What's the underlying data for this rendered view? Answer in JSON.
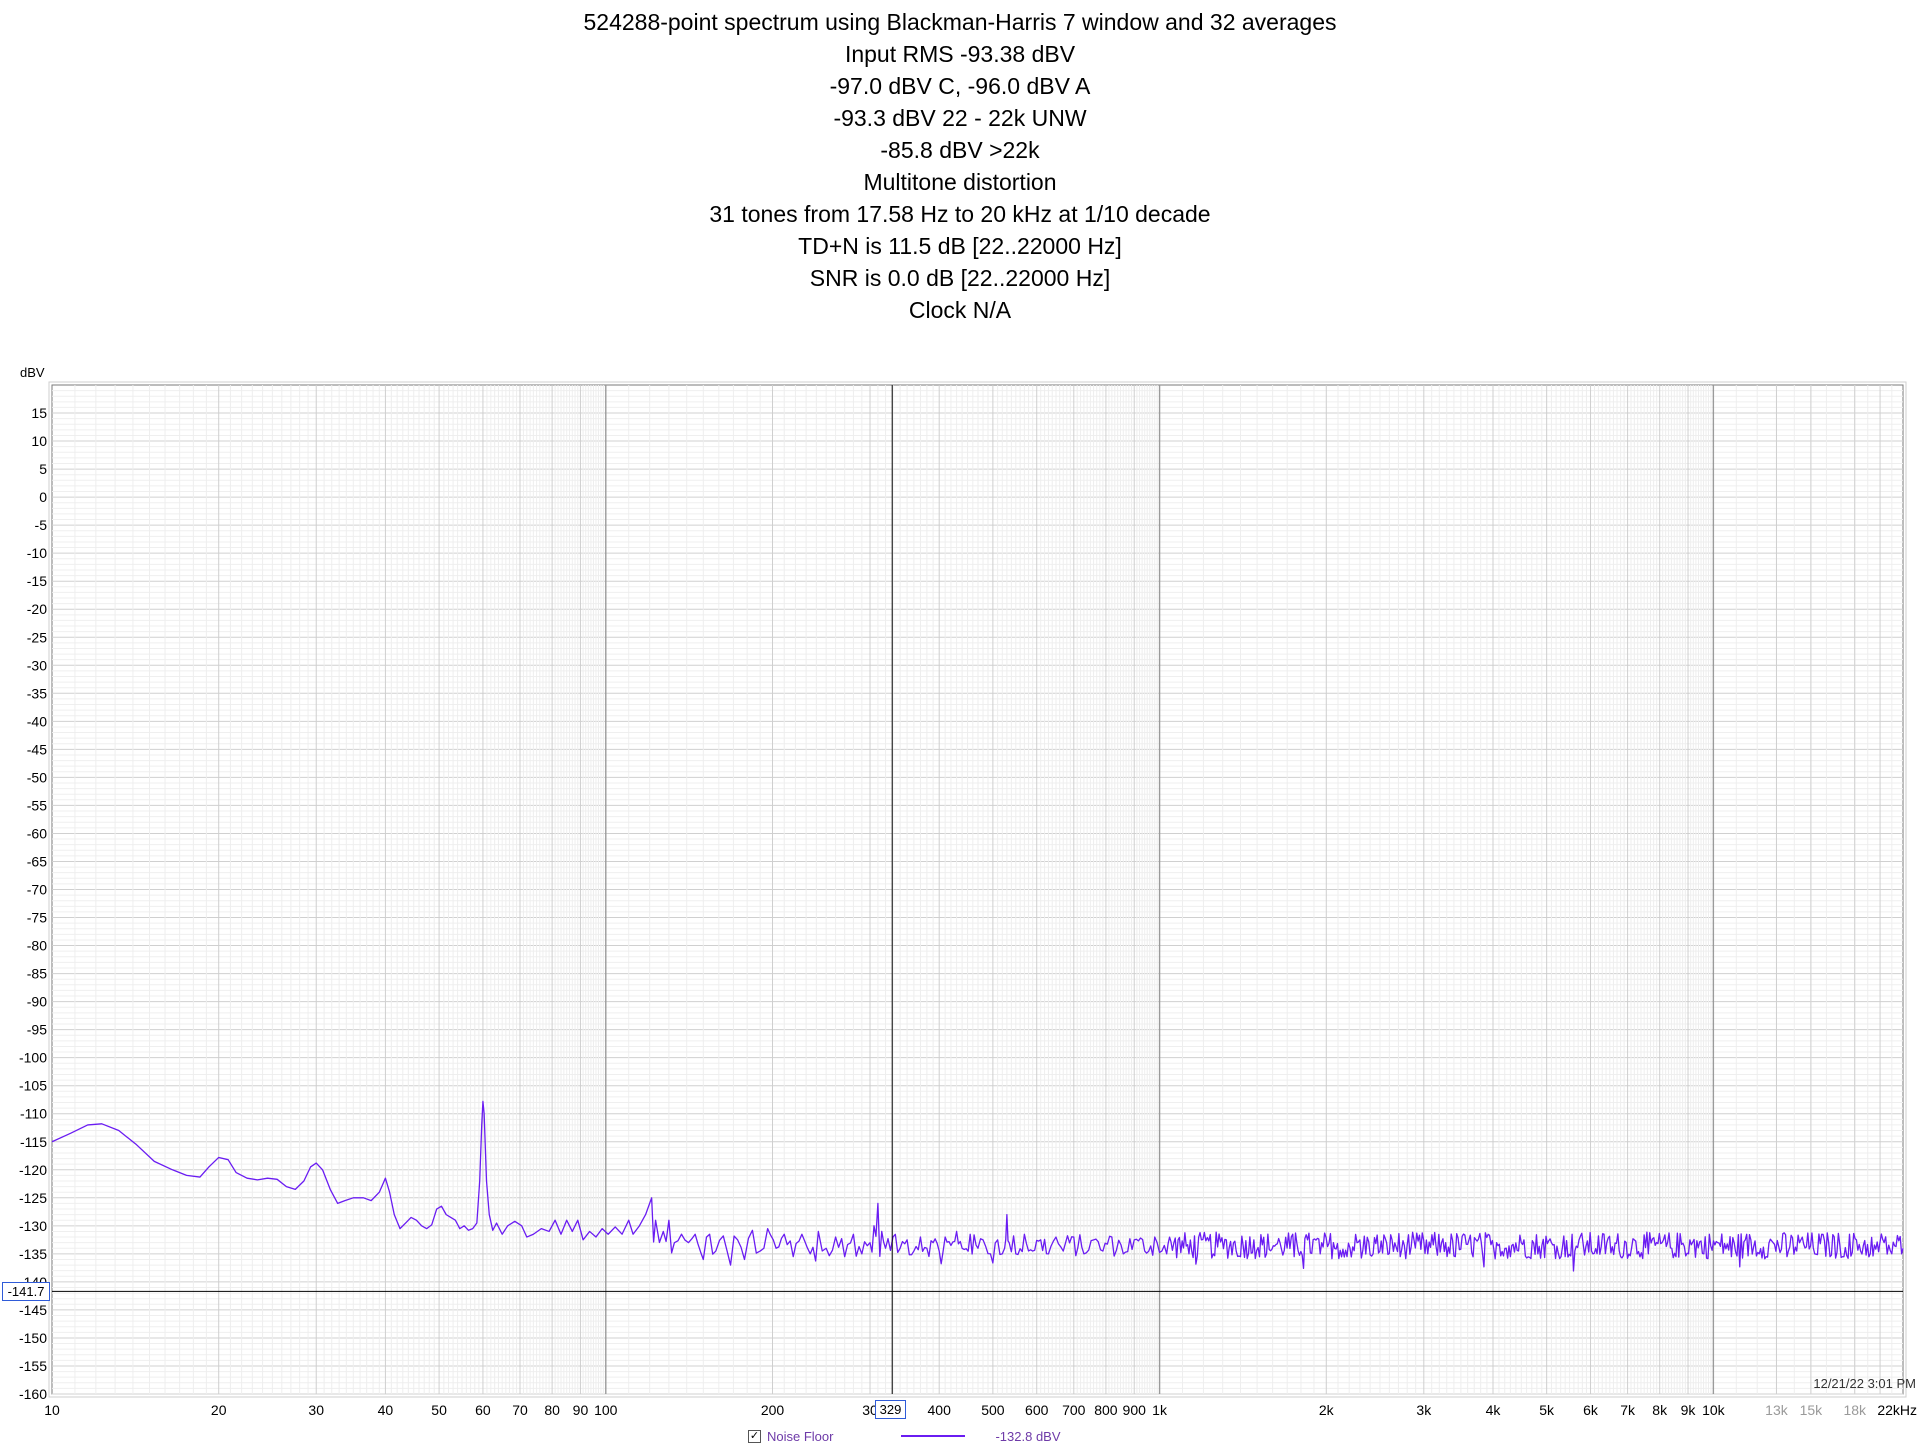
{
  "chart_data": {
    "type": "line",
    "title_lines": [
      "524288-point spectrum using Blackman-Harris 7 window and 32 averages",
      "Input RMS -93.38 dBV",
      "-97.0 dBV C, -96.0 dBV A",
      "-93.3 dBV 22 - 22k UNW",
      "-85.8 dBV >22k",
      "Multitone distortion",
      "31 tones from 17.58 Hz to 20 kHz at 1/10 decade",
      "TD+N is 11.5 dB [22..22000 Hz]",
      "SNR is 0.0 dB [22..22000 Hz]",
      "Clock N/A"
    ],
    "ylabel": "dBV",
    "xlabel": "Hz",
    "x_scale": "log",
    "xlim": [
      10,
      22000
    ],
    "ylim": [
      -160,
      20
    ],
    "y_ticks": [
      15,
      10,
      5,
      0,
      -5,
      -10,
      -15,
      -20,
      -25,
      -30,
      -35,
      -40,
      -45,
      -50,
      -55,
      -60,
      -65,
      -70,
      -75,
      -80,
      -85,
      -90,
      -95,
      -100,
      -105,
      -110,
      -115,
      -120,
      -125,
      -130,
      -135,
      -140,
      -145,
      -150,
      -155,
      -160
    ],
    "x_ticks": [
      {
        "value": 10,
        "label": "10"
      },
      {
        "value": 20,
        "label": "20"
      },
      {
        "value": 30,
        "label": "30"
      },
      {
        "value": 40,
        "label": "40"
      },
      {
        "value": 50,
        "label": "50"
      },
      {
        "value": 60,
        "label": "60"
      },
      {
        "value": 70,
        "label": "70"
      },
      {
        "value": 80,
        "label": "80"
      },
      {
        "value": 90,
        "label": "90"
      },
      {
        "value": 100,
        "label": "100"
      },
      {
        "value": 200,
        "label": "200"
      },
      {
        "value": 300,
        "label": "30"
      },
      {
        "value": 400,
        "label": "400"
      },
      {
        "value": 500,
        "label": "500"
      },
      {
        "value": 600,
        "label": "600"
      },
      {
        "value": 700,
        "label": "700"
      },
      {
        "value": 800,
        "label": "800"
      },
      {
        "value": 900,
        "label": "900"
      },
      {
        "value": 1000,
        "label": "1k"
      },
      {
        "value": 2000,
        "label": "2k"
      },
      {
        "value": 3000,
        "label": "3k"
      },
      {
        "value": 4000,
        "label": "4k"
      },
      {
        "value": 5000,
        "label": "5k"
      },
      {
        "value": 6000,
        "label": "6k"
      },
      {
        "value": 7000,
        "label": "7k"
      },
      {
        "value": 8000,
        "label": "8k"
      },
      {
        "value": 9000,
        "label": "9k"
      },
      {
        "value": 10000,
        "label": "10k"
      },
      {
        "value": 13000,
        "label": "13k",
        "dim": true
      },
      {
        "value": 15000,
        "label": "15k",
        "dim": true
      },
      {
        "value": 18000,
        "label": "18k",
        "dim": true
      },
      {
        "value": 22000,
        "label": "22kHz"
      }
    ],
    "grid": true,
    "series": [
      {
        "name": "Noise Floor",
        "color": "#6a1cf2",
        "points": [
          [
            10,
            -115
          ],
          [
            10.8,
            -113.5
          ],
          [
            11.6,
            -112
          ],
          [
            12.3,
            -111.8
          ],
          [
            13.2,
            -113
          ],
          [
            14.2,
            -115.5
          ],
          [
            15.3,
            -118.5
          ],
          [
            16.5,
            -120
          ],
          [
            17.5,
            -121
          ],
          [
            18.5,
            -121.3
          ],
          [
            19.2,
            -119.5
          ],
          [
            20,
            -117.8
          ],
          [
            20.8,
            -118.2
          ],
          [
            21.5,
            -120.5
          ],
          [
            22.5,
            -121.5
          ],
          [
            23.5,
            -121.8
          ],
          [
            24.5,
            -121.5
          ],
          [
            25.5,
            -121.7
          ],
          [
            26.5,
            -123
          ],
          [
            27.5,
            -123.5
          ],
          [
            28.5,
            -122
          ],
          [
            29.3,
            -119.5
          ],
          [
            30,
            -118.8
          ],
          [
            30.8,
            -120
          ],
          [
            31.8,
            -123.5
          ],
          [
            32.8,
            -126
          ],
          [
            33.8,
            -125.5
          ],
          [
            35,
            -125
          ],
          [
            36.5,
            -125
          ],
          [
            37.7,
            -125.5
          ],
          [
            39,
            -124
          ],
          [
            40,
            -121.5
          ],
          [
            40.7,
            -124
          ],
          [
            41.5,
            -128
          ],
          [
            42.5,
            -130.5
          ],
          [
            43.5,
            -129.5
          ],
          [
            44.5,
            -128.5
          ],
          [
            45.5,
            -129
          ],
          [
            46.5,
            -130
          ],
          [
            47.5,
            -130.5
          ],
          [
            48.5,
            -129.8
          ],
          [
            49.5,
            -127
          ],
          [
            50.5,
            -126.5
          ],
          [
            51.5,
            -128
          ],
          [
            52.5,
            -128.5
          ],
          [
            53.5,
            -129
          ],
          [
            54.5,
            -130.5
          ],
          [
            55.5,
            -130
          ],
          [
            56.5,
            -130.8
          ],
          [
            57.5,
            -130.5
          ],
          [
            58.5,
            -129.5
          ],
          [
            59.2,
            -122
          ],
          [
            59.7,
            -112
          ],
          [
            60,
            -107.8
          ],
          [
            60.3,
            -110
          ],
          [
            60.9,
            -122
          ],
          [
            61.6,
            -128
          ],
          [
            62.5,
            -130.8
          ],
          [
            63.5,
            -129.5
          ],
          [
            65,
            -131.5
          ],
          [
            66.5,
            -130
          ],
          [
            68.5,
            -129.2
          ],
          [
            70.5,
            -130
          ],
          [
            72,
            -132
          ],
          [
            74,
            -131.5
          ],
          [
            76.5,
            -130.5
          ],
          [
            79,
            -131
          ],
          [
            81,
            -129
          ],
          [
            83,
            -131.5
          ],
          [
            85,
            -129
          ],
          [
            87,
            -131
          ],
          [
            89,
            -129
          ],
          [
            91,
            -132.5
          ],
          [
            93.5,
            -131
          ],
          [
            96,
            -132
          ],
          [
            98.5,
            -130.5
          ],
          [
            101,
            -131.5
          ],
          [
            104,
            -130.2
          ],
          [
            107,
            -131.5
          ],
          [
            110,
            -129
          ],
          [
            112,
            -131.5
          ],
          [
            115,
            -130
          ],
          [
            118,
            -128
          ],
          [
            121,
            -125
          ],
          [
            123,
            -129
          ],
          [
            127,
            -131
          ],
          [
            130,
            -129
          ],
          [
            133,
            -133
          ],
          [
            137,
            -131.5
          ],
          [
            141,
            -133
          ],
          [
            145,
            -131.5
          ],
          [
            150,
            -136
          ],
          [
            154,
            -131.5
          ],
          [
            158,
            -134.5
          ],
          [
            163,
            -131.8
          ],
          [
            168,
            -137
          ],
          [
            173,
            -132.5
          ],
          [
            178,
            -136
          ],
          [
            184,
            -130.8
          ],
          [
            190,
            -134.5
          ],
          [
            196,
            -130.5
          ],
          [
            203,
            -134
          ],
          [
            210,
            -131.5
          ],
          [
            218,
            -135.5
          ],
          [
            226,
            -131.5
          ],
          [
            234,
            -135
          ],
          [
            242,
            -131
          ],
          [
            250,
            -134
          ],
          [
            260,
            -132
          ],
          [
            270,
            -135.5
          ],
          [
            280,
            -131.5
          ],
          [
            290,
            -135
          ],
          [
            300,
            -133
          ],
          [
            305,
            -130
          ],
          [
            310,
            -126
          ],
          [
            315,
            -131
          ],
          [
            320,
            -134
          ],
          [
            330,
            -132
          ],
          [
            340,
            -134
          ],
          [
            350,
            -132.5
          ],
          [
            360,
            -134.5
          ],
          [
            370,
            -132
          ],
          [
            380,
            -134
          ],
          [
            390,
            -133
          ],
          [
            400,
            -134.5
          ],
          [
            410,
            -132
          ],
          [
            420,
            -133.5
          ],
          [
            430,
            -131
          ],
          [
            440,
            -134
          ],
          [
            455,
            -131.5
          ],
          [
            470,
            -134
          ],
          [
            480,
            -132.5
          ],
          [
            495,
            -135
          ],
          [
            510,
            -132.5
          ],
          [
            525,
            -134
          ],
          [
            530,
            -128
          ],
          [
            535,
            -133
          ],
          [
            550,
            -135
          ],
          [
            570,
            -131.5
          ],
          [
            590,
            -134.5
          ],
          [
            610,
            -132.5
          ],
          [
            630,
            -135
          ],
          [
            650,
            -132
          ],
          [
            670,
            -134.5
          ],
          [
            700,
            -132
          ],
          [
            730,
            -135
          ],
          [
            760,
            -132.5
          ],
          [
            790,
            -134.5
          ],
          [
            820,
            -132
          ],
          [
            860,
            -135
          ],
          [
            900,
            -132.5
          ],
          [
            940,
            -134.5
          ],
          [
            980,
            -132
          ],
          [
            1030,
            -135
          ],
          [
            1080,
            -132.5
          ],
          [
            1130,
            -135
          ],
          [
            1190,
            -132.5
          ],
          [
            1250,
            -135
          ],
          [
            1320,
            -132.5
          ],
          [
            1400,
            -135.5
          ],
          [
            1480,
            -132.5
          ],
          [
            1560,
            -135
          ],
          [
            1650,
            -133
          ],
          [
            1750,
            -135.5
          ],
          [
            1850,
            -132.5
          ],
          [
            1950,
            -135
          ],
          [
            2060,
            -133
          ],
          [
            2180,
            -135.5
          ],
          [
            2300,
            -132.5
          ],
          [
            2430,
            -135
          ],
          [
            2570,
            -133
          ],
          [
            2720,
            -135.5
          ],
          [
            2880,
            -132.5
          ],
          [
            3050,
            -135
          ],
          [
            3230,
            -133
          ],
          [
            3420,
            -135.5
          ],
          [
            3620,
            -132.5
          ],
          [
            3830,
            -135
          ],
          [
            4060,
            -133
          ],
          [
            4300,
            -135.5
          ],
          [
            4550,
            -132.5
          ],
          [
            4820,
            -135
          ],
          [
            5100,
            -133
          ],
          [
            5400,
            -135.5
          ],
          [
            5720,
            -132.5
          ],
          [
            6060,
            -135
          ],
          [
            6420,
            -133
          ],
          [
            6800,
            -135.5
          ],
          [
            7200,
            -132.5
          ],
          [
            7630,
            -135
          ],
          [
            8080,
            -133
          ],
          [
            8560,
            -135.5
          ],
          [
            9070,
            -132.5
          ],
          [
            9610,
            -135
          ],
          [
            10180,
            -133
          ],
          [
            10780,
            -135.5
          ],
          [
            11420,
            -132.5
          ],
          [
            12100,
            -135
          ],
          [
            12820,
            -133
          ],
          [
            13580,
            -135.5
          ],
          [
            14390,
            -132.5
          ],
          [
            15240,
            -135
          ],
          [
            16150,
            -133
          ],
          [
            17110,
            -135.5
          ],
          [
            18130,
            -132.5
          ],
          [
            19200,
            -135
          ],
          [
            20340,
            -133
          ],
          [
            21000,
            -135
          ],
          [
            22000,
            -134
          ]
        ]
      }
    ],
    "cursor": {
      "x": 329,
      "y": -141.7,
      "x_label": "329",
      "y_label": "-141.7"
    },
    "legend": {
      "checked": "✓",
      "name": "Noise Floor",
      "value": "-132.8 dBV",
      "placement": "bottom"
    },
    "timestamp": "12/21/22 3:01 PM"
  }
}
